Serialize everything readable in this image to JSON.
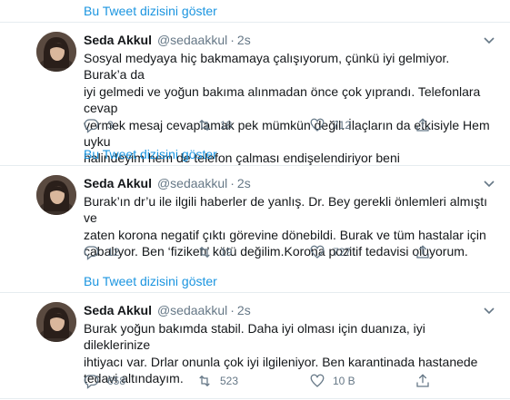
{
  "thread_link_label": "Bu Tweet dizisini göster",
  "tweets": [
    {
      "name": "Seda Akkul",
      "handle": "@sedaakkul",
      "dot": "·",
      "time": "2s",
      "text": "Sosyal medyaya hiç  bakmamaya çalışıyorum, çünkü iyi gelmiyor. Burak’a da\niyi gelmedi ve yoğun bakıma alınmadan önce çok yıprandı. Telefonlara cevap\nvermek mesaj cevaplamak pek mümkün değil. İlaçların da etkisiyle Hem uyku\nhalindeyim hem de telefon çalması endişelendiriyor beni",
      "replies": "3",
      "retweets": "18",
      "likes": "712"
    },
    {
      "name": "Seda Akkul",
      "handle": "@sedaakkul",
      "dot": "·",
      "time": "2s",
      "text": "Burak’ın dr’u  ile ilgili haberler de yanlış. Dr. Bey gerekli önlemleri almıştı ve\nzaten korona negatif çıktı görevine dönebildi. Burak ve tüm hastalar için\ncabalıyor. Ben ‘fiziken’ kötü değilim.Korona pozitif tedavisi oluyorum.",
      "replies": "12",
      "retweets": "19",
      "likes": "727"
    },
    {
      "name": "Seda Akkul",
      "handle": "@sedaakkul",
      "dot": "·",
      "time": "2s",
      "text": "Burak yoğun bakımda stabil. Daha iyi olması için duanıza, iyi dileklerinize\nihtiyacı var.  Drlar onunla çok iyi ilgileniyor. Ben karantinada hastanede\ntedavi altındayım.",
      "replies": "658",
      "retweets": "523",
      "likes": "10 B"
    }
  ],
  "colors": {
    "link": "#1b95e0",
    "secondary_text": "#657786",
    "border": "#e6ecf0"
  },
  "icons": {
    "reply": "reply-icon",
    "retweet": "retweet-icon",
    "like": "heart-icon",
    "share": "share-icon",
    "caret": "chevron-down-icon"
  }
}
